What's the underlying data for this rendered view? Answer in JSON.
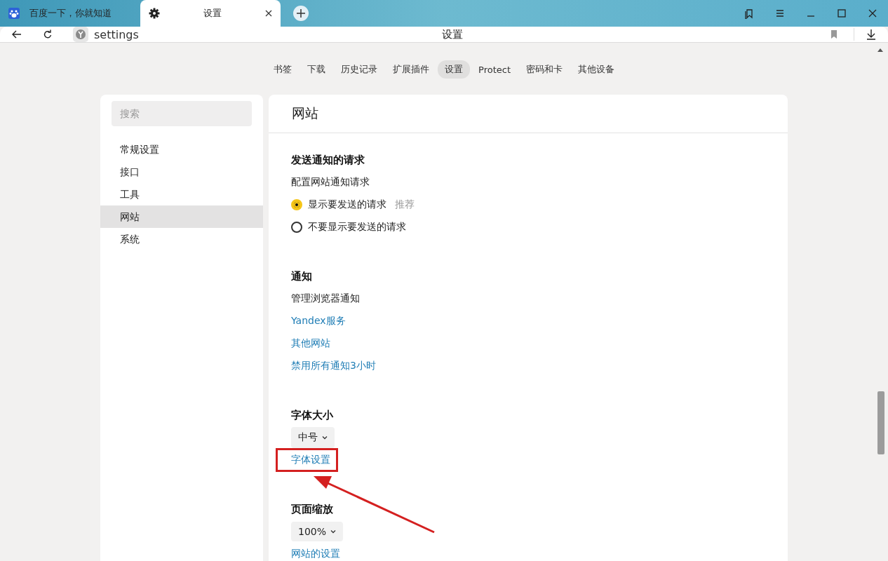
{
  "tabs": [
    {
      "title": "百度一下，你就知道",
      "selected": false,
      "closable": false
    },
    {
      "title": "设置",
      "selected": true,
      "closable": true
    }
  ],
  "address_bar": {
    "url": "settings",
    "page_title": "设置"
  },
  "nav": [
    {
      "label": "书签",
      "selected": false
    },
    {
      "label": "下载",
      "selected": false
    },
    {
      "label": "历史记录",
      "selected": false
    },
    {
      "label": "扩展插件",
      "selected": false
    },
    {
      "label": "设置",
      "selected": true
    },
    {
      "label": "Protect",
      "selected": false
    },
    {
      "label": "密码和卡",
      "selected": false
    },
    {
      "label": "其他设备",
      "selected": false
    }
  ],
  "sidebar": {
    "search": {
      "placeholder": "搜索"
    },
    "items": [
      {
        "label": "常规设置",
        "selected": false
      },
      {
        "label": "接口",
        "selected": false
      },
      {
        "label": "工具",
        "selected": false
      },
      {
        "label": "网站",
        "selected": true
      },
      {
        "label": "系统",
        "selected": false
      }
    ]
  },
  "content": {
    "title": "网站",
    "sections": [
      {
        "title": "发送通知的请求",
        "items": [
          {
            "kind": "text",
            "text": "配置网站通知请求"
          },
          {
            "kind": "radio",
            "text": "显示要发送的请求",
            "note": "推荐",
            "selected": true
          },
          {
            "kind": "radio",
            "text": "不要显示要发送的请求",
            "selected": false
          }
        ]
      },
      {
        "title": "通知",
        "items": [
          {
            "kind": "text",
            "text": "管理浏览器通知"
          },
          {
            "kind": "link",
            "text": "Yandex服务",
            "highlighted": false
          },
          {
            "kind": "link",
            "text": "其他网站",
            "highlighted": false
          },
          {
            "kind": "link",
            "text": "禁用所有通知3小时",
            "highlighted": false
          }
        ]
      },
      {
        "title": "字体大小",
        "items": [
          {
            "kind": "select",
            "text": "中号"
          },
          {
            "kind": "link",
            "text": "字体设置",
            "highlighted": true
          }
        ]
      },
      {
        "title": "页面缩放",
        "items": [
          {
            "kind": "select",
            "text": "100%"
          },
          {
            "kind": "link",
            "text": "网站的设置",
            "highlighted": false
          }
        ]
      }
    ]
  }
}
